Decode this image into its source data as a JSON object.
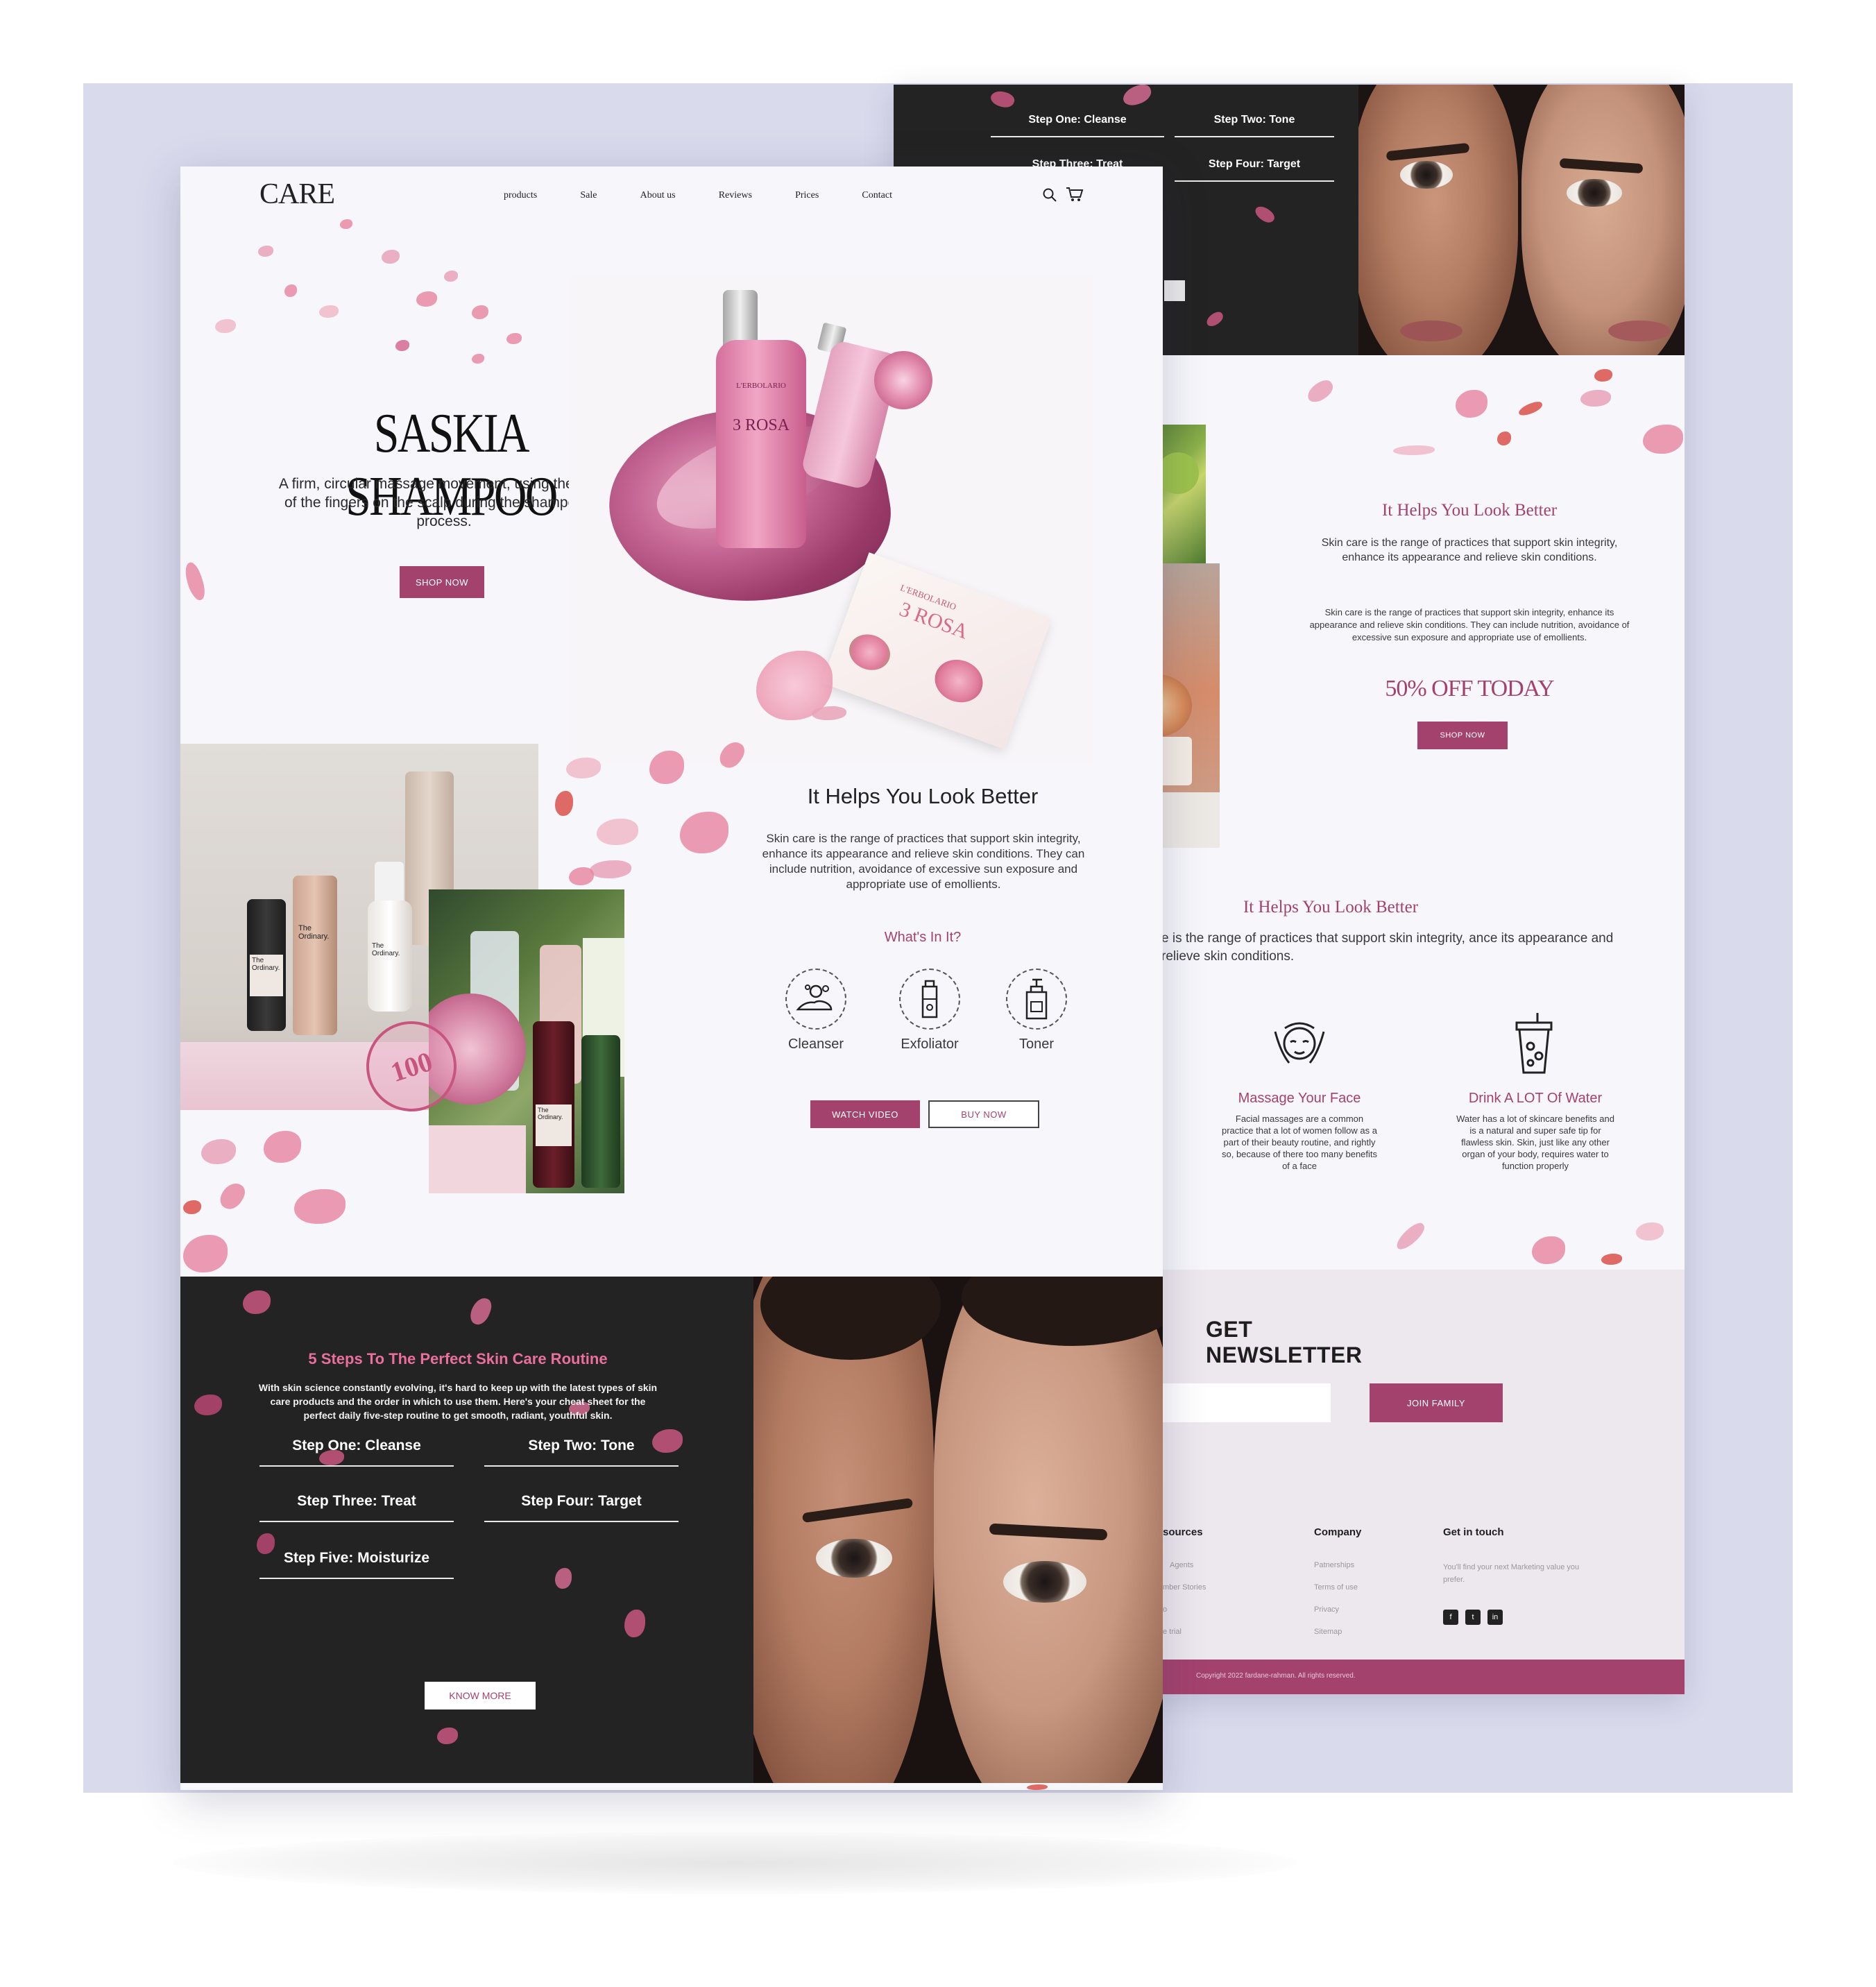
{
  "brand": {
    "logo": "CARE"
  },
  "nav": {
    "items": [
      "products",
      "Sale",
      "About us",
      "Reviews",
      "Prices",
      "Contact"
    ]
  },
  "hero": {
    "title": "SASKIA SHAMPOO",
    "subtitle": "A firm, circular massage movement, using the pads of the fingers on the scalp during the shampooing process.",
    "cta": "SHOP NOW",
    "product_brand": "L'ERBOLARIO",
    "product_name": "3 ROSA",
    "box_brand": "L'ERBOLARIO",
    "box_name": "3 ROSA"
  },
  "feature": {
    "title": "It Helps You Look Better",
    "body": "Skin care is the range of practices that support skin integrity, enhance its appearance and relieve skin conditions. They can include nutrition, avoidance of excessive sun exposure and appropriate use of emollients.",
    "whats_in": "What's In It?",
    "ingredients": [
      "Cleanser",
      "Exfoliator",
      "Toner"
    ],
    "watch_label": "WATCH VIDEO",
    "buy_label": "BUY NOW",
    "bottle_labels": [
      "The Ordinary.",
      "The Ordinary.",
      "The Ordinary.",
      "The Ordinary."
    ],
    "stamp": "100"
  },
  "routine": {
    "title": "5 Steps To The Perfect Skin Care Routine",
    "body": "With skin science constantly evolving, it's hard to keep up with the latest types of skin care products and the order in which to use them. Here's your cheat sheet for the perfect daily five-step routine to get smooth, radiant, youthful skin.",
    "steps": [
      "Step One: Cleanse",
      "Step Two: Tone",
      "Step Three: Treat",
      "Step Four: Target",
      "Step Five: Moisturize"
    ],
    "cta": "KNOW MORE"
  },
  "back": {
    "steps": [
      "Step One: Cleanse",
      "Step Two: Tone",
      "Step Three: Treat",
      "Step Four: Target"
    ],
    "promo_title": "It Helps You Look Better",
    "promo_body1": "Skin care is the range of practices that support skin integrity, enhance its appearance and relieve skin conditions.",
    "promo_body2": "Skin care is the range of practices that support skin integrity, enhance its appearance and relieve skin conditions. They can include nutrition, avoidance of excessive sun exposure and appropriate use of emollients.",
    "offer": "50% OFF TODAY",
    "offer_cta": "SHOP NOW",
    "tips_title": "It Helps You Look Better",
    "tips_body": "e is the range of practices that support skin integrity, ance its appearance and relieve skin conditions.",
    "tips": [
      {
        "title": "Massage Your Face",
        "body": "Facial massages are a common practice that a lot of women follow as a part of their beauty routine, and rightly so, because of there too many benefits of a face"
      },
      {
        "title": "Drink A LOT Of Water",
        "body": "Water has a lot of skincare benefits and is a natural and super safe tip for flawless skin. Skin, just like any other organ of your body, requires water to function properly"
      }
    ],
    "newsletter_title": "GET NEWSLETTER",
    "newsletter_cta": "JOIN FAMILY",
    "footer_cols": [
      {
        "title": "sources",
        "links": [
          "Agents",
          "mber Stories",
          "o",
          "e trial"
        ]
      },
      {
        "title": "Company",
        "links": [
          "Patnerships",
          "Terms of use",
          "Privacy",
          "Sitemap"
        ]
      },
      {
        "title": "Get in touch",
        "links": [
          "You'll find your next Marketing value you prefer."
        ]
      }
    ],
    "social": [
      "f",
      "t",
      "in"
    ],
    "copyright": "Copyright 2022 fardane-rahman. All rights reserved."
  },
  "colors": {
    "accent": "#a4426e",
    "dark": "#232323",
    "backdrop": "#d9daec",
    "page": "#f6f6fb",
    "petal": "#e88aa6"
  },
  "icons": {
    "search": "search-icon",
    "cart": "cart-icon"
  }
}
